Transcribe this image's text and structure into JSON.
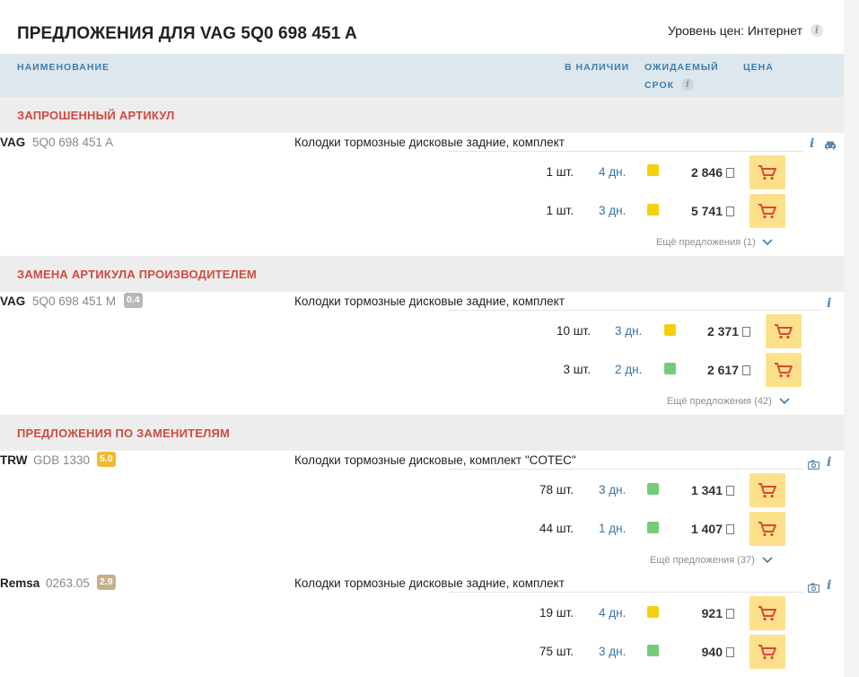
{
  "header": {
    "title": "ПРЕДЛОЖЕНИЯ ДЛЯ VAG 5Q0 698 451 A",
    "price_level": "Уровень цен: Интернет",
    "info_glyph": "i"
  },
  "columns": {
    "name": "НАИМЕНОВАНИЕ",
    "stock": "В НАЛИЧИИ",
    "expected_1": "ОЖИДАЕМЫЙ",
    "expected_2": "СРОК",
    "price": "ЦЕНА"
  },
  "sections": [
    {
      "title": "ЗАПРОШЕННЫЙ АРТИКУЛ"
    },
    {
      "title": "ЗАМЕНА АРТИКУЛА ПРОИЗВОДИТЕЛЕМ"
    },
    {
      "title": "ПРЕДЛОЖЕНИЯ ПО ЗАМЕНИТЕЛЯМ"
    }
  ],
  "products": [
    {
      "brand": "VAG",
      "part": "5Q0 698 451 A",
      "badge": "",
      "description": "Колодки тормозные дисковые задние, комплект",
      "icons": [
        "info-icon",
        "car-icon"
      ],
      "offers": [
        {
          "qty": "1 шт.",
          "days": "4 дн.",
          "status": "yellow",
          "price": "2 846"
        },
        {
          "qty": "1 шт.",
          "days": "3 дн.",
          "status": "yellow",
          "price": "5 741"
        }
      ],
      "more": "Ещё предложения (1)"
    },
    {
      "brand": "VAG",
      "part": "5Q0 698 451 M",
      "badge": "0.4",
      "description": "Колодки тормозные дисковые задние, комплект",
      "icons": [
        "info-icon"
      ],
      "offers": [
        {
          "qty": "10 шт.",
          "days": "3 дн.",
          "status": "yellow",
          "price": "2 371"
        },
        {
          "qty": "3 шт.",
          "days": "2 дн.",
          "status": "green",
          "price": "2 617"
        }
      ],
      "more": "Ещё предложения (42)"
    },
    {
      "brand": "TRW",
      "part": "GDB 1330",
      "badge": "5.0",
      "description": "Колодки тормозные дисковые, комплект \"COTEC\"",
      "icons": [
        "camera-icon",
        "info-icon"
      ],
      "offers": [
        {
          "qty": "78 шт.",
          "days": "3 дн.",
          "status": "green",
          "price": "1 341"
        },
        {
          "qty": "44 шт.",
          "days": "1 дн.",
          "status": "green",
          "price": "1 407"
        }
      ],
      "more": "Ещё предложения (37)"
    },
    {
      "brand": "Remsa",
      "part": "0263.05",
      "badge": "2.9",
      "description": "Колодки тормозные дисковые задние, комплект",
      "icons": [
        "camera-icon",
        "info-icon"
      ],
      "offers": [
        {
          "qty": "19 шт.",
          "days": "4 дн.",
          "status": "yellow",
          "price": "921"
        },
        {
          "qty": "75 шт.",
          "days": "3 дн.",
          "status": "green",
          "price": "940"
        }
      ],
      "more": ""
    }
  ],
  "colors": {
    "accent_blue": "#3d7da8",
    "section_red": "#cc4c3f",
    "cart_bg": "#fde08a",
    "cart_icon": "#d9473a",
    "status_yellow": "#f3d10b",
    "status_green": "#74cc7a",
    "badge_grey": "#b8b8b8",
    "badge_gold": "#eebc2f",
    "badge_tan": "#c5b08a"
  }
}
